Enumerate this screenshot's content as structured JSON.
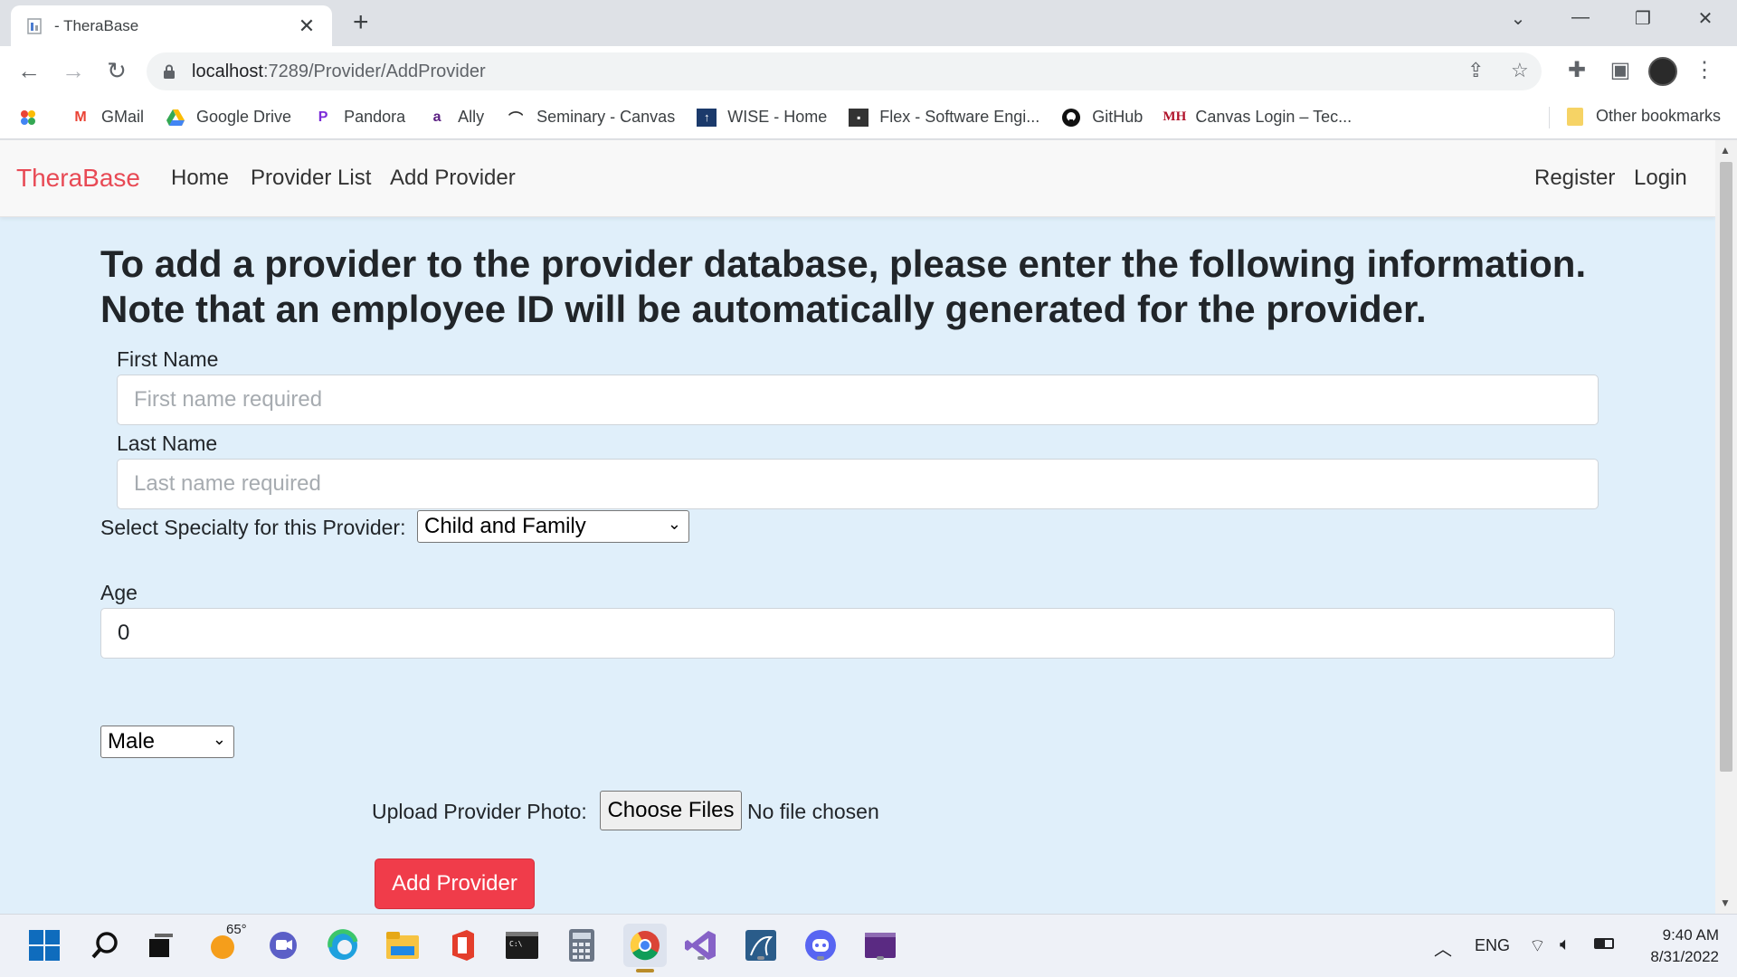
{
  "browser": {
    "tab_title": " - TheraBase",
    "url_host": "localhost",
    "url_path": ":7289/Provider/AddProvider",
    "bookmarks": [
      {
        "label": "GMail",
        "icon": "gmail-icon"
      },
      {
        "label": "Google Drive",
        "icon": "google-drive-icon"
      },
      {
        "label": "Pandora",
        "icon": "pandora-icon"
      },
      {
        "label": "Ally",
        "icon": "ally-icon"
      },
      {
        "label": "Seminary - Canvas",
        "icon": "canvas-icon"
      },
      {
        "label": "WISE - Home",
        "icon": "wise-icon"
      },
      {
        "label": "Flex - Software Engi...",
        "icon": "flex-icon"
      },
      {
        "label": "GitHub",
        "icon": "github-icon"
      },
      {
        "label": "Canvas Login – Tec...",
        "icon": "mh-icon"
      }
    ],
    "other_bookmarks": "Other bookmarks"
  },
  "navbar": {
    "brand": "TheraBase",
    "links": [
      "Home",
      "Provider List",
      "Add Provider"
    ],
    "register": "Register",
    "login": "Login"
  },
  "form": {
    "heading_line1": "To add a provider to the provider database, please enter the following information.",
    "heading_line2": "Note that an employee ID will be automatically generated for the provider.",
    "first_name_label": "First Name",
    "first_name_placeholder": "First name required",
    "last_name_label": "Last Name",
    "last_name_placeholder": "Last name required",
    "specialty_label": "Select Specialty for this Provider:",
    "specialty_selected": "Child and Family",
    "age_label": "Age",
    "age_value": "0",
    "gender_selected": "Male",
    "photo_label": "Upload Provider Photo:",
    "choose_files": "Choose Files",
    "no_file": "No file chosen",
    "submit_label": "Add Provider"
  },
  "taskbar": {
    "weather_temp": "65°",
    "language": "ENG",
    "time": "9:40 AM",
    "date": "8/31/2022"
  },
  "colors": {
    "page_bg": "#e0effa",
    "brand": "#e84a55",
    "submit_bg": "#f03c4a"
  }
}
